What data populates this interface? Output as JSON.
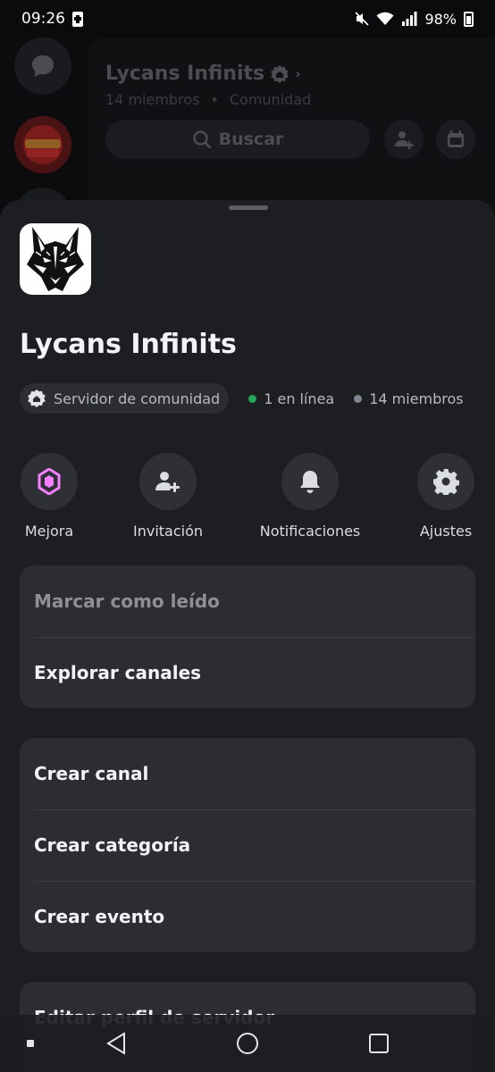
{
  "status_bar": {
    "time": "09:26",
    "battery": "98%"
  },
  "background_app": {
    "server_title": "Lycans Infinits",
    "members": "14 miembros",
    "separator": "•",
    "type": "Comunidad",
    "search_label": "Buscar"
  },
  "sheet": {
    "server_name": "Lycans Infinits",
    "community_badge": "Servidor de comunidad",
    "online": "1 en línea",
    "members": "14 miembros",
    "online_color": "#23a55a",
    "members_color": "#80848e"
  },
  "actions": [
    {
      "label": "Mejora",
      "icon": "boost-gem-icon"
    },
    {
      "label": "Invitación",
      "icon": "add-user-icon"
    },
    {
      "label": "Notificaciones",
      "icon": "bell-icon"
    },
    {
      "label": "Ajustes",
      "icon": "gear-icon"
    }
  ],
  "menu_group_1": [
    "Marcar como leído",
    "Explorar canales"
  ],
  "menu_group_2": [
    "Crear canal",
    "Crear categoría",
    "Crear evento"
  ],
  "menu_group_3": [
    "Editar perfil de servidor"
  ],
  "colors": {
    "boost_accent": "#f47fff",
    "sheet_bg": "#1d1e22",
    "card_bg": "#2b2d31"
  }
}
